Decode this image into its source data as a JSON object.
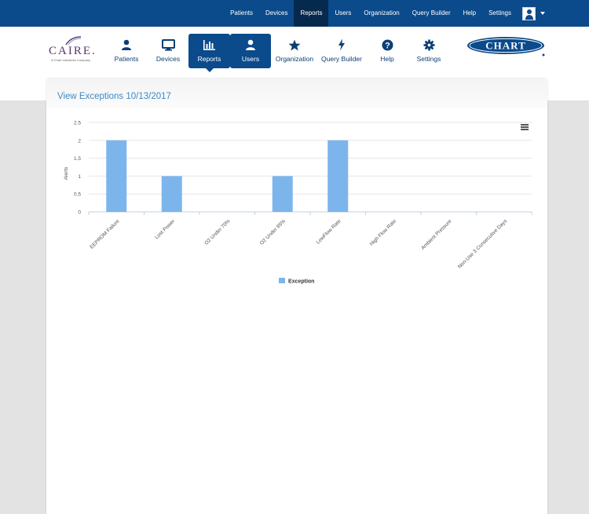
{
  "topnav": {
    "items": [
      "Patients",
      "Devices",
      "Reports",
      "Users",
      "Organization",
      "Query Builder",
      "Help",
      "Settings"
    ],
    "active_index": 2
  },
  "brand": {
    "caire_name": "CAIRE.",
    "caire_tagline": "A Chart Industries Company",
    "chart_name": "CHART"
  },
  "mainnav": {
    "items": [
      {
        "label": "Patients",
        "icon": "person-icon"
      },
      {
        "label": "Devices",
        "icon": "monitor-icon"
      },
      {
        "label": "Reports",
        "icon": "bar-chart-icon"
      },
      {
        "label": "Users",
        "icon": "user-icon"
      },
      {
        "label": "Organization",
        "icon": "star-icon"
      },
      {
        "label": "Query Builder",
        "icon": "bolt-icon"
      },
      {
        "label": "Help",
        "icon": "question-icon"
      },
      {
        "label": "Settings",
        "icon": "gear-icon"
      }
    ]
  },
  "panel": {
    "title": "View Exceptions 10/13/2017"
  },
  "colors": {
    "primary": "#0b4a8b",
    "bar": "#7cb5ec",
    "title": "#3d8ac6"
  },
  "chart_data": {
    "type": "bar",
    "categories": [
      "EEPROM Failure",
      "Lost Power",
      "O2 Under 70%",
      "O2 Under 85%",
      "LowFlow Rate",
      "High Flow Rate",
      "Ambient Pressure",
      "Non-Use 3 Consecutive Days"
    ],
    "series": [
      {
        "name": "Exception",
        "values": [
          2,
          1,
          0,
          1,
          2,
          0,
          0,
          0
        ]
      }
    ],
    "ylabel": "Alerts",
    "yticks": [
      "0",
      "0.5",
      "1",
      "1.5",
      "2",
      "2.5"
    ],
    "ylim": [
      0,
      2.5
    ],
    "grid": true,
    "legend": "bottom-center"
  }
}
